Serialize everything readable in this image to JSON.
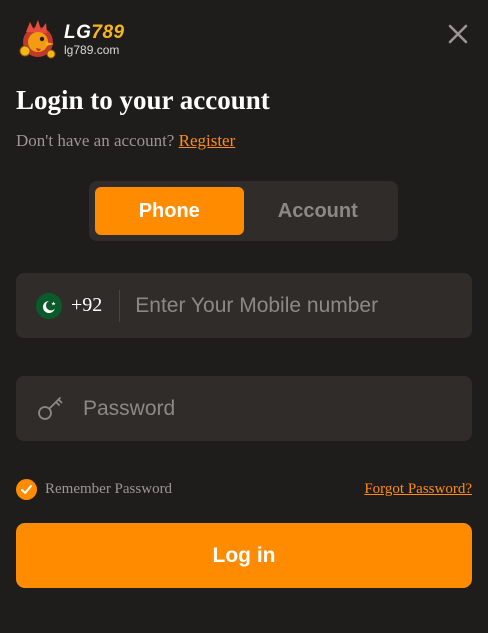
{
  "brand": {
    "name_main": "LG",
    "name_accent": "789",
    "domain": "lg789.com"
  },
  "close_icon": "close-icon",
  "heading": {
    "title": "Login to your account",
    "prompt": "Don't have an account?",
    "register_link": "Register"
  },
  "tabs": [
    {
      "label": "Phone",
      "active": true
    },
    {
      "label": "Account",
      "active": false
    }
  ],
  "phone": {
    "flag_icon": "pakistan-flag-icon",
    "country_code": "+92",
    "placeholder": "Enter Your Mobile number",
    "value": ""
  },
  "password": {
    "icon": "key-icon",
    "placeholder": "Password",
    "value": ""
  },
  "remember": {
    "label": "Remember Password",
    "checked": true
  },
  "forgot_link": "Forgot Password?",
  "login_button": "Log in",
  "colors": {
    "accent": "#ff8c00",
    "background": "#1f1d1c",
    "field": "#302c2a",
    "muted_text": "#9a9693"
  }
}
